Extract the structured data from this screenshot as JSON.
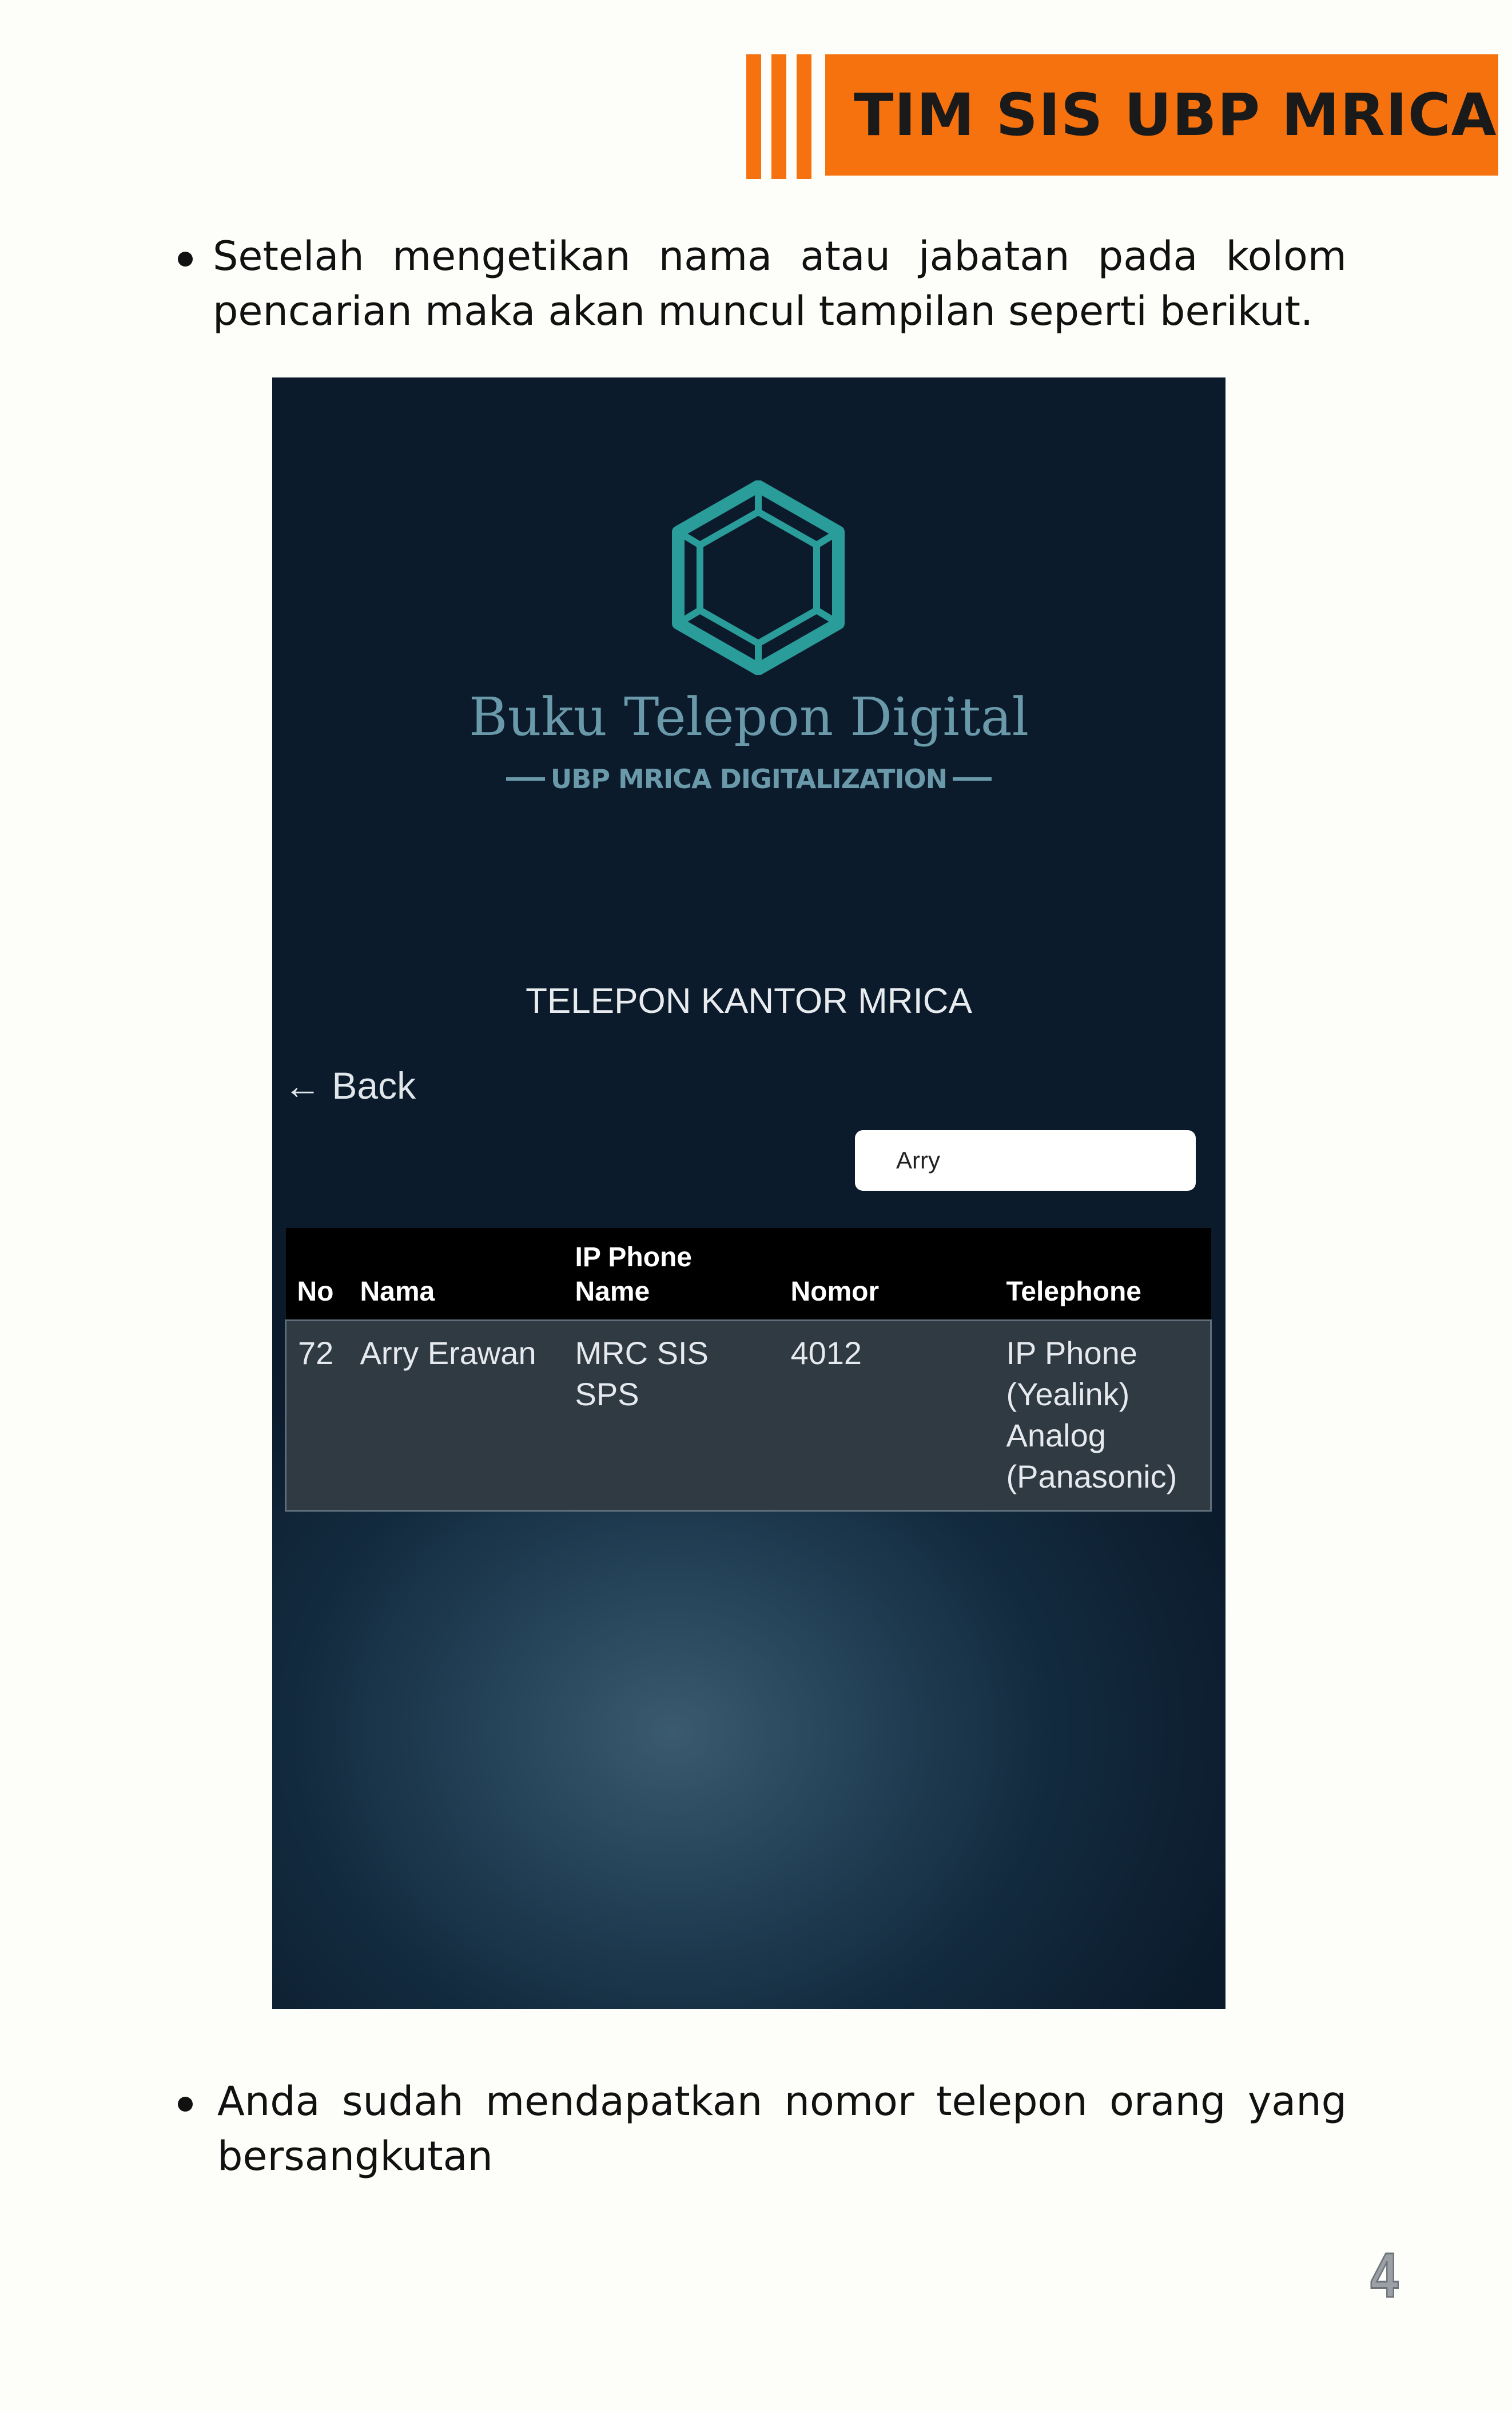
{
  "header": {
    "title": "TIM SIS UBP MRICA",
    "accent_color": "#f5720f"
  },
  "bullets": [
    "Setelah mengetikan nama atau jabatan pada kolom pencarian maka akan muncul tampilan seperti berikut.",
    "Anda sudah mendapatkan nomor telepon orang yang bersangkutan"
  ],
  "screenshot": {
    "logo": {
      "title": "Buku Telepon Digital",
      "subtitle": "UBP MRICA DIGITALIZATION",
      "icon": "hexagon-icon",
      "color": "#2a9d9a"
    },
    "heading": "TELEPON KANTOR MRICA",
    "back_label": "← Back",
    "search": {
      "value": "Arry"
    },
    "table": {
      "headers": [
        "No",
        "Nama",
        "IP Phone Name",
        "Nomor",
        "Telephone"
      ],
      "rows": [
        {
          "no": "72",
          "nama": "Arry Erawan",
          "ip_phone_name": "MRC SIS SPS",
          "nomor": "4012",
          "telephone": "IP Phone (Yealink) Analog (Panasonic)"
        }
      ]
    }
  },
  "page_number": "4"
}
